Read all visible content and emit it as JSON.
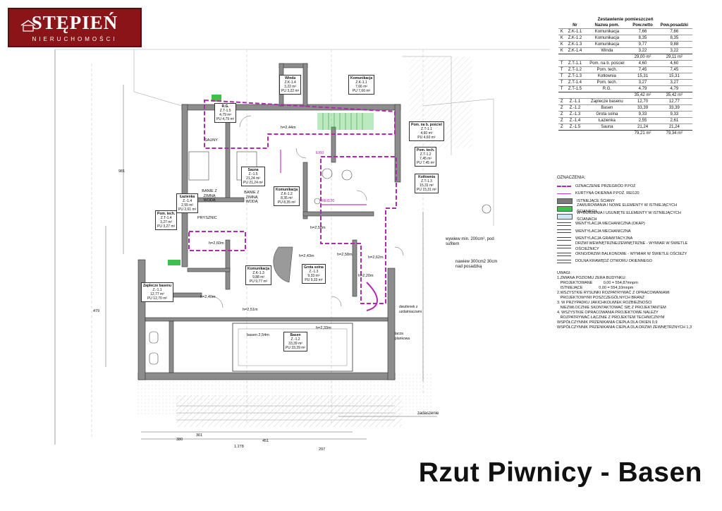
{
  "logo": {
    "brand": "STĘPIEŃ",
    "sub": "NIERUCHOMOŚCI"
  },
  "title": "Rzut Piwnicy - Basen",
  "room_table": {
    "heading": "Zestawienie pomieszczeń",
    "columns": [
      "Nr",
      "Nazwa pom.",
      "Pow.netto",
      "Pow.posadzki"
    ],
    "groups": [
      {
        "rows": [
          [
            "K",
            "Z.K-1.1",
            "Komunikacja",
            "7,66",
            "7,66"
          ],
          [
            "K",
            "Z.K-1.2",
            "Komunikacja",
            "8,35",
            "8,35"
          ],
          [
            "K",
            "Z.K-1.3",
            "Komunikacja",
            "9,77",
            "9,88"
          ],
          [
            "K",
            "Z.K-1.4",
            "Winda",
            "3,22",
            "3,22"
          ]
        ],
        "sum": [
          "29,00 m²",
          "29,11 m²"
        ]
      },
      {
        "rows": [
          [
            "T",
            "Z.T-1.1",
            "Pom. na b. pościel",
            "4,60",
            "4,60"
          ],
          [
            "T",
            "Z.T-1.2",
            "Pom. tech.",
            "7,45",
            "7,45"
          ],
          [
            "T",
            "Z.T-1.3",
            "Kotłownia",
            "15,31",
            "15,31"
          ],
          [
            "T",
            "Z.T-1.4",
            "Pom. tech.",
            "3,27",
            "3,27"
          ],
          [
            "T",
            "Z.T-1.5",
            "R.G.",
            "4,79",
            "4,79"
          ]
        ],
        "sum": [
          "35,42 m²",
          "35,42 m²"
        ]
      },
      {
        "rows": [
          [
            "Z",
            "Z.-1.1",
            "Zaplecze basenu",
            "12,70",
            "12,77"
          ],
          [
            "Z",
            "Z.-1.2",
            "Basen",
            "33,39",
            "33,39"
          ],
          [
            "Z",
            "Z.-1.3",
            "Grota solna",
            "9,33",
            "9,33"
          ],
          [
            "Z",
            "Z.-1.4",
            "Łazienka",
            "2,55",
            "2,61"
          ],
          [
            "Z",
            "Z.-1.5",
            "Sauna",
            "21,24",
            "21,24"
          ]
        ],
        "sum": [
          "79,21 m²",
          "79,34 m²"
        ]
      }
    ]
  },
  "legend": {
    "heading": "OZNACZENIA:",
    "items": [
      {
        "label": "OZNACZENIE PRZEGRÓD P.POŻ",
        "color": "#b02ab0",
        "style": "dash"
      },
      {
        "label": "KURTYNA OKIENNA P.POŻ. REI120",
        "color": "#c33ec3",
        "style": "line"
      },
      {
        "label": "ISTNIEJĄCE ŚCIANY",
        "color": "#7a7a7a",
        "style": "fill"
      },
      {
        "label": "ZAMUROWANIA I NOWE ELEMENTY W ISTNIEJĄCYCH ŚCIANACH",
        "color": "#3fbf4f",
        "style": "fill"
      },
      {
        "label": "WYBURZENIA I USUNIĘTE ELEMENTY W ISTNIEJĄCYCH ŚCIANACH",
        "color": "#cfe6f5",
        "style": "fill"
      },
      {
        "label": "WENTYLACJA MECHANICZNA (OKAP)",
        "color": "#444444",
        "style": "symbol"
      },
      {
        "label": "WENTYLACJA MECHANICZNA",
        "color": "#444444",
        "style": "symbol"
      },
      {
        "label": "WENTYLACJA GRAWITACYJNA",
        "color": "#444444",
        "style": "symbol"
      },
      {
        "label": "DRZWI WEWNĘTRZNE/ZEWNĘTRZNE - WYMIAR W ŚWIETLE OŚCIEŻNICY",
        "color": "#444444",
        "style": "symbol"
      },
      {
        "label": "OKNO/DRZWI BALKONOWE - WYMIAR W ŚWIETLE OŚCIEŻY",
        "color": "#444444",
        "style": "symbol"
      },
      {
        "label": "DOLNA KRAWĘDŹ OTWORU OKIENNEGO",
        "color": "#444444",
        "style": "symbol"
      }
    ]
  },
  "notes": {
    "heading": "UWAGI:",
    "lines": [
      "1.ZMIANA POZIOMU ZERA BUDYNKU:",
      "   PROJEKTOWANE          0,00 = 554,87mnpm",
      "   ISTNIEJĄCE               0,00 = 554,10mnpm",
      "2.WSZYSTKIE RYSUNKI ROZPATRYWAĆ Z OPRACOWANIAMI",
      "   PROJEKTOWYMI POSZCZEGÓLNYCH BRANŻ",
      "3. W PRZYPADKU JAKICHKOLWIEK ROZBIEŻNOŚCI",
      "   NIEZWŁOCZNIE SKONTAKTOWAĆ SIĘ Z PROJEKTANTEM",
      "4. WSZYSTKIE OPRACOWANIA PROJEKTOWE NALEŻY",
      "   ROZPATRYWAĆ ŁĄCZNIE Z PROJEKTEM TECHNICZNYM",
      "WSPÓŁCZYNNIK PRZENIKANIA CIEPŁA DLA OKIEN 0,9",
      "WSPÓŁCZYNNIK PRZENIKANIA CIEPŁA DLA DRZWI ZEWNĘTRZNYCH 1,3"
    ]
  },
  "plan": {
    "room_labels": [
      {
        "name": "Winda",
        "code": "Z.K-1.4",
        "area": "3,22 m²",
        "pu": "PU 3,22 m²"
      },
      {
        "name": "Komunikacja",
        "code": "Z.K-1.1",
        "area": "7,66 m²",
        "pu": "PU 7,66 m²"
      },
      {
        "name": "R.G.",
        "code": "Z.T-1.5",
        "area": "4,79 m²",
        "pu": "PU 4,79 m²"
      },
      {
        "name": "Pom. na b. pościel",
        "code": "Z.T-1.1",
        "area": "4,60 m²",
        "pu": "PU 4,60 m²"
      },
      {
        "name": "Pom. tech.",
        "code": "Z.T-1.2",
        "area": "7,45 m²",
        "pu": "PU 7,45 m²"
      },
      {
        "name": "Kotłownia",
        "code": "Z.T-1.3",
        "area": "15,31 m²",
        "pu": "PU 15,31 m²"
      },
      {
        "name": "Sauna",
        "code": "Z.-1.5",
        "area": "21,24 m²",
        "pu": "PU 21,24 m²"
      },
      {
        "name": "Komunikacja",
        "code": "Z.K-1.2",
        "area": "8,35 m²",
        "pu": "PU 8,35 m²"
      },
      {
        "name": "Łazienka",
        "code": "Z.-1.4",
        "area": "2,55 m²",
        "pu": "PU 2,61 m²"
      },
      {
        "name": "Pom. tech.",
        "code": "Z.T-1.4",
        "area": "3,27 m²",
        "pu": "PU 3,27 m²"
      },
      {
        "name": "Komunikacja",
        "code": "Z.K-1.3",
        "area": "9,88 m²",
        "pu": "PU 9,77 m²"
      },
      {
        "name": "Grota solna",
        "code": "Z.-1.3",
        "area": "9,33 m²",
        "pu": "PU 9,33 m²"
      },
      {
        "name": "Zaplecze basenu",
        "code": "Z.-1.1",
        "area": "12,77 m²",
        "pu": "PU 12,70 m²"
      },
      {
        "name": "Basen",
        "code": "Z.-1.2",
        "area": "33,39 m²",
        "pu": "PU 33,39 m²"
      }
    ],
    "text": {
      "sauny": "SAUNY",
      "bania1": "BANIE Z ZIMNĄ WODĄ",
      "bania2": "BANIE Z ZIMNĄ WODĄ",
      "prysznic": "PRYSZNIC",
      "basen_h": "basen 2,54m",
      "h1": "h=2,44m",
      "h2": "h=2,58m",
      "h3": "h=2,60m",
      "h4": "h=2,43m",
      "h5": "h=2,58m",
      "h6": "h=2,62m",
      "h7": "h=2,20m",
      "h8": "h=2,51m",
      "h9": "h=2,33m",
      "h10": "h=2,40m",
      "wywiew": "wywiew min. 200cm², pod sufitem",
      "nawiew": "nawiew 300cm2 30cm nad posadzką",
      "zadaszenie": "zadaszenie",
      "dwutlenek": "dwutlenek z uzdatniaczami",
      "tacza": "tacza plankowa",
      "rei": "REI120",
      "ei60": "EI60",
      "dim_1278": "1.278",
      "dim_451": "451",
      "dim_297": "297",
      "dim_380": "380",
      "dim_361": "361",
      "dim_479": "479",
      "dim_981": "981"
    }
  }
}
